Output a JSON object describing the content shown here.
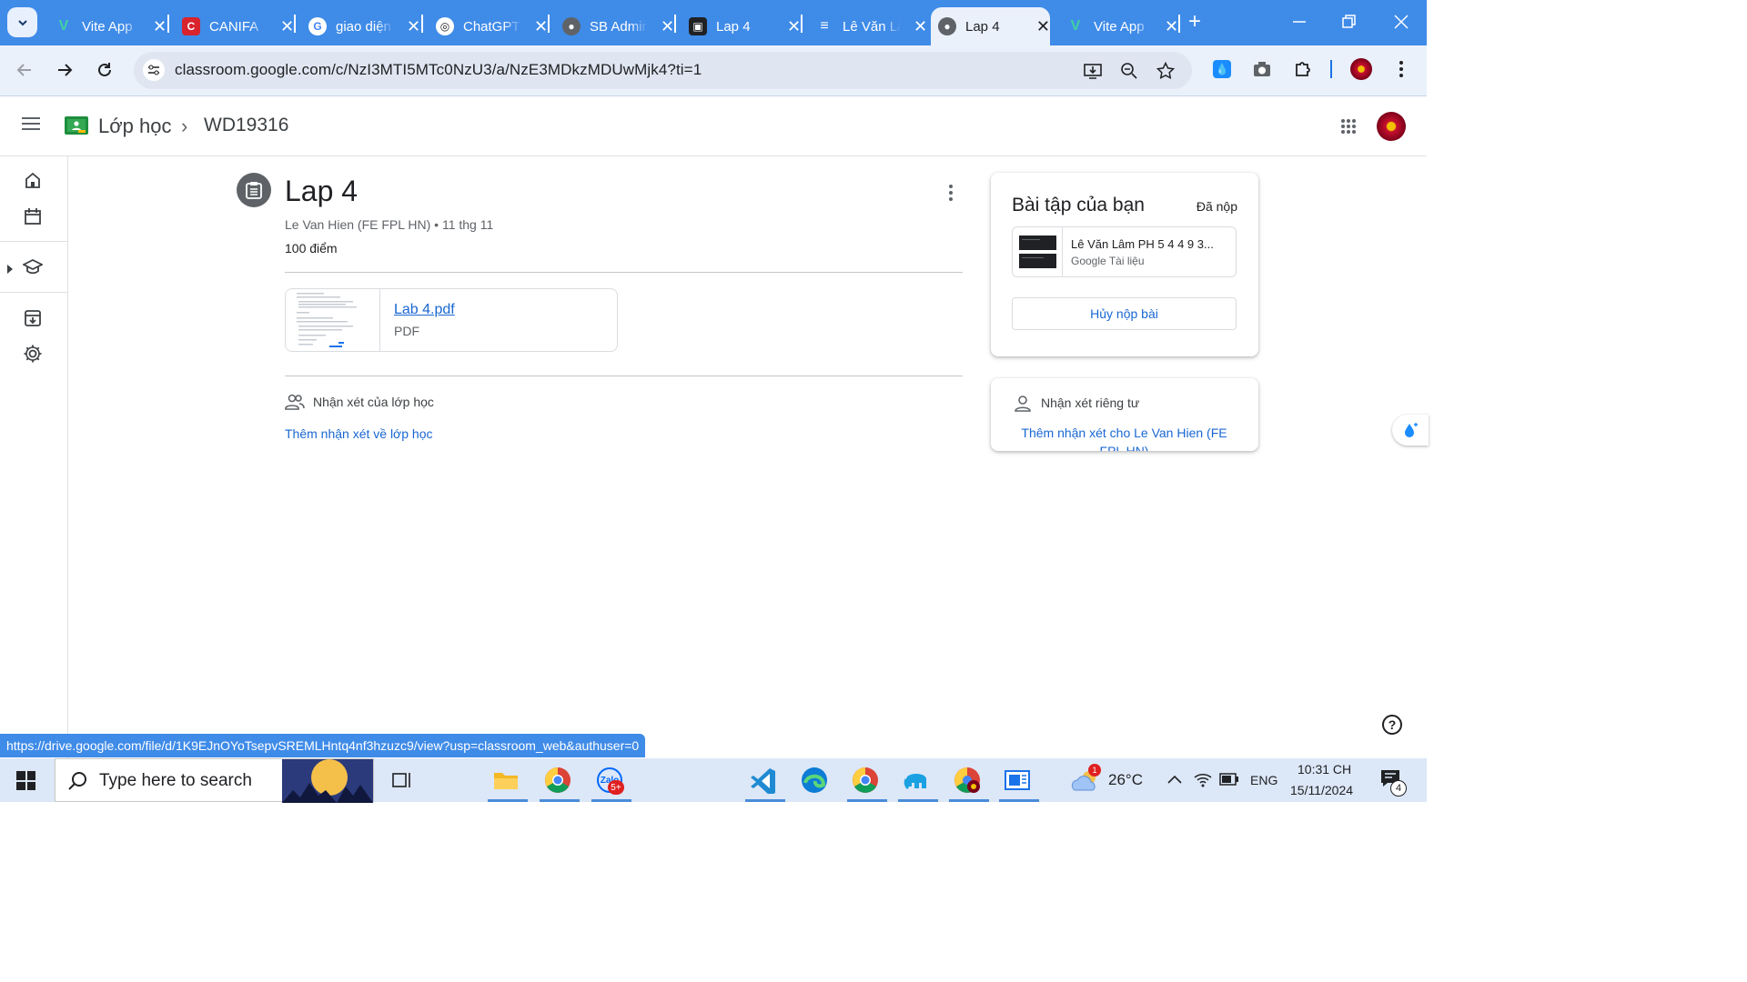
{
  "browser": {
    "tabs": [
      {
        "title": "Vite App",
        "favicon": "vite-icon",
        "active": false
      },
      {
        "title": "CANIFA",
        "favicon": "canifa-icon",
        "active": false
      },
      {
        "title": "giao diện",
        "favicon": "google-icon",
        "active": false
      },
      {
        "title": "ChatGPT",
        "favicon": "chatgpt-icon",
        "active": false
      },
      {
        "title": "SB Admin",
        "favicon": "globe-icon",
        "active": false
      },
      {
        "title": "Lap 4",
        "favicon": "classroom-icon",
        "active": false
      },
      {
        "title": "Lê Văn Lâm",
        "favicon": "docs-icon",
        "active": false
      },
      {
        "title": "Lap 4",
        "favicon": "globe-icon",
        "active": true
      },
      {
        "title": "Vite App",
        "favicon": "vite-icon",
        "active": false
      }
    ],
    "close_glyph": "✕",
    "new_tab_glyph": "+",
    "url": "classroom.google.com/c/NzI3MTI5MTc0NzU3/a/NzE3MDkzMDUwMjk4?ti=1",
    "status_url": "https://drive.google.com/file/d/1K9EJnOYoTsepvSREMLHntq4nf3hzuzc9/view?usp=classroom_web&authuser=0"
  },
  "classroom": {
    "breadcrumb_root": "Lớp học",
    "breadcrumb_sep": "›",
    "class_name": "WD19316"
  },
  "assignment": {
    "title": "Lap 4",
    "meta": "Le Van Hien (FE FPL HN) • 11 thg 11",
    "points": "100 điểm",
    "attachment": {
      "name": "Lab 4.pdf",
      "type": "PDF"
    },
    "class_comments_label": "Nhận xét của lớp học",
    "class_comments_add": "Thêm nhận xét về lớp học"
  },
  "your_work": {
    "title": "Bài tập của bạn",
    "status": "Đã nộp",
    "file_name": "Lê Văn Lâm PH 5 4 4 9 3...",
    "file_type": "Google Tài liệu",
    "unsubmit_label": "Hủy nộp bài"
  },
  "private_comments": {
    "label": "Nhận xét riêng tư",
    "add": "Thêm nhận xét cho Le Van Hien (FE FPL HN)"
  },
  "help_glyph": "?",
  "taskbar": {
    "search_placeholder": "Type here to search",
    "zalo_badge": "5+",
    "weather_badge": "1",
    "temperature": "26°C",
    "language": "ENG",
    "time": "10:31 CH",
    "date": "15/11/2024",
    "notifications": "4"
  },
  "colors": {
    "chrome_blue": "#3f8be8",
    "link_blue": "#1967d2",
    "classroom_green": "#1e8e3e"
  }
}
